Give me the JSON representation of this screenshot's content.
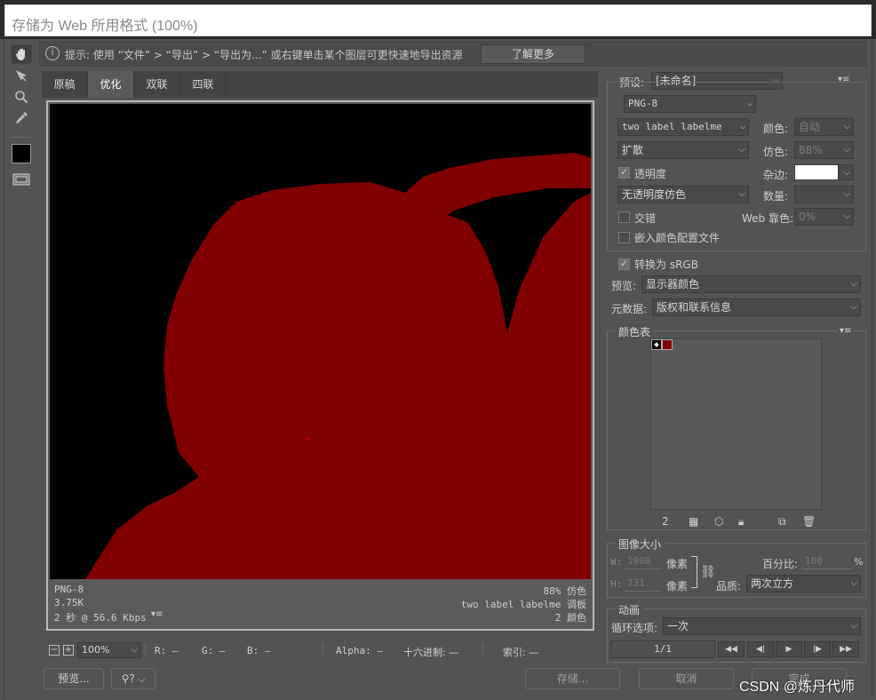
{
  "window": {
    "title": "存储为 Web 所用格式 (100%)"
  },
  "hint": {
    "text": "提示: 使用 “文件” > “导出” > “导出为...” 或右键单击某个图层可更快速地导出资源",
    "learn_more": "了解更多"
  },
  "tabs": [
    "原稿",
    "优化",
    "双联",
    "四联"
  ],
  "preview": {
    "format": "PNG-8",
    "size": "3.75K",
    "time": "2 秒 @ 56.6 Kbps",
    "dither": "88% 仿色",
    "palette": "two label labelme 调板",
    "colors": "2 颜色",
    "image_bg": "#000000",
    "image_fg": "#800000"
  },
  "status": {
    "zoom": "100%",
    "r": "R: —",
    "g": "G: —",
    "b": "B: —",
    "alpha": "Alpha: —",
    "hex": "十六进制: —",
    "index": "索引: —"
  },
  "buttons": {
    "preview": "预览...",
    "save": "存储...",
    "cancel": "取消",
    "done": "完成"
  },
  "settings": {
    "preset_label": "预设:",
    "preset_value": "[未命名]",
    "format": "PNG-8",
    "reduction": "two label labelme",
    "colors_label": "颜色:",
    "colors_value": "自动",
    "dither_algo": "扩散",
    "dither_label": "仿色:",
    "dither_value": "88%",
    "transparency": "透明度",
    "matte_label": "杂边:",
    "trans_dither": "无透明度仿色",
    "amount_label": "数量:",
    "interlaced": "交错",
    "web_snap_label": "Web 靠色:",
    "web_snap_value": "0%",
    "embed_profile": "嵌入颜色配置文件",
    "convert_srgb": "转换为 sRGB",
    "preview_label": "预览:",
    "preview_value": "显示器颜色",
    "metadata_label": "元数据:",
    "metadata_value": "版权和联系信息"
  },
  "color_table": {
    "title": "颜色表",
    "count": "2",
    "swatches": [
      "#000000",
      "#800000"
    ]
  },
  "image_size": {
    "title": "图像大小",
    "w_label": "W:",
    "w_value": "1000",
    "h_label": "H:",
    "h_value": "731",
    "unit": "像素",
    "percent_label": "百分比:",
    "percent_value": "100",
    "percent_unit": "%",
    "quality_label": "品质:",
    "quality_value": "两次立方"
  },
  "animation": {
    "title": "动画",
    "loop_label": "循环选项:",
    "loop_value": "一次",
    "frame": "1/1"
  },
  "watermark": "CSDN @炼丹代师"
}
